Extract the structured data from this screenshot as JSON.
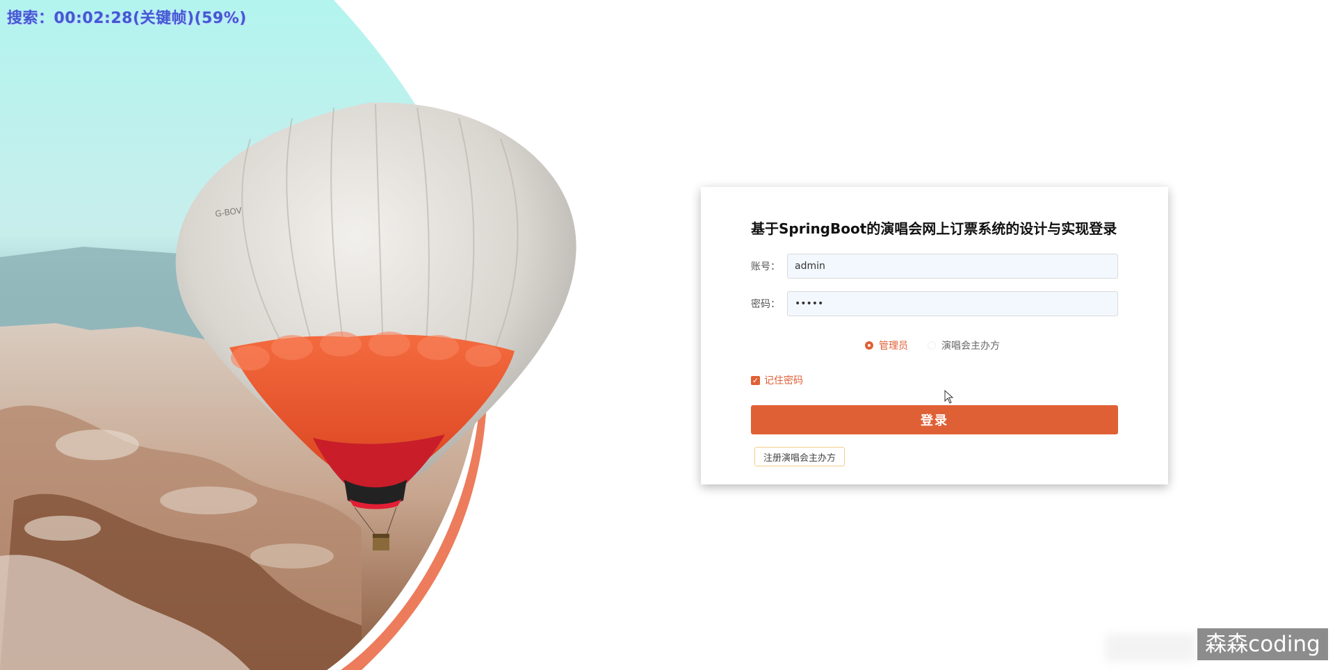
{
  "overlay": {
    "text": "搜索：00:02:28(关键帧)(59%)"
  },
  "login": {
    "title": "基于SpringBoot的演唱会网上订票系统的设计与实现登录",
    "account_label": "账号：",
    "account_value": "admin",
    "password_label": "密码：",
    "password_value": "•••••",
    "roles": [
      {
        "label": "管理员",
        "selected": true
      },
      {
        "label": "演唱会主办方",
        "selected": false
      }
    ],
    "remember_label": "记住密码",
    "remember_checked": true,
    "login_button": "登录",
    "register_button": "注册演唱会主办方"
  },
  "watermark": {
    "text": "森森coding"
  },
  "colors": {
    "accent": "#e06035",
    "card_bg": "#ffffff",
    "input_bg": "#f3f8fe"
  }
}
